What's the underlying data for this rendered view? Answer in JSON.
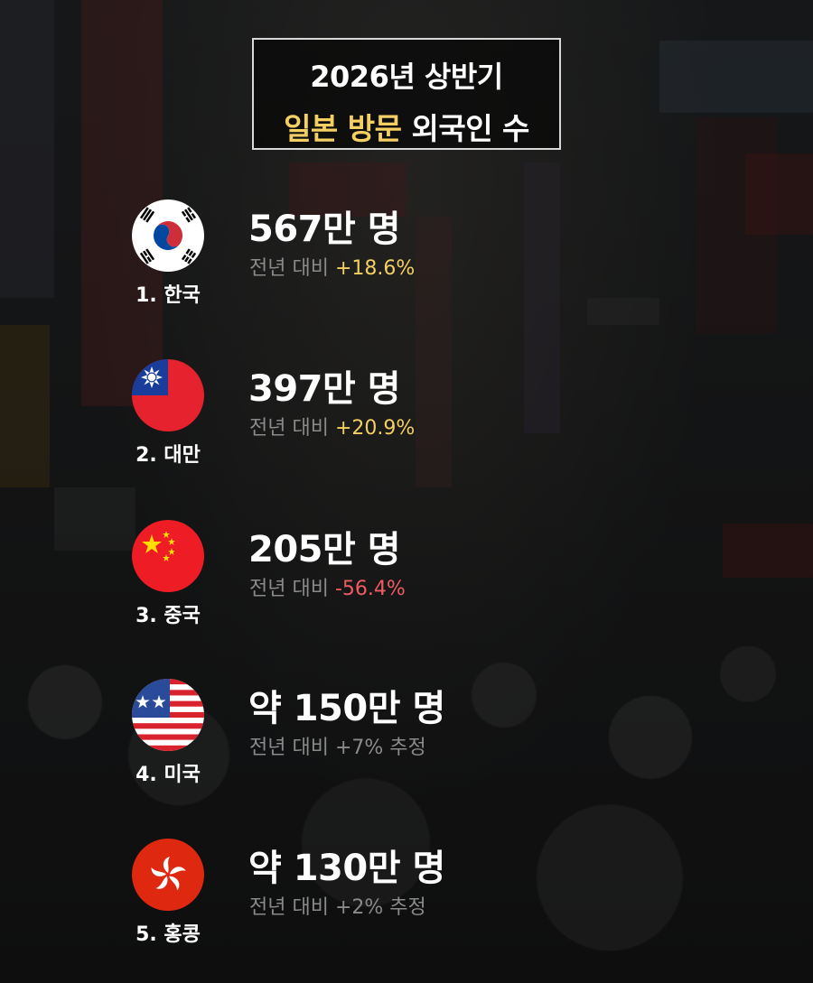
{
  "header": {
    "line1": "2026년 상반기",
    "line2_highlight": "일본 방문",
    "line2_rest": " 외국인 수"
  },
  "colors": {
    "accent_gold": "#f4cf62",
    "negative_red": "#ef5b63",
    "muted_gray": "#8a8a8a"
  },
  "ranking": [
    {
      "rank_label": "1. 한국",
      "count": "567만 명",
      "change_prefix": "전년 대비 ",
      "change_value": "+18.6%",
      "flag": "south-korea-flag-icon"
    },
    {
      "rank_label": "2. 대만",
      "count": "397만 명",
      "change_prefix": "전년 대비 ",
      "change_value": "+20.9%",
      "flag": "taiwan-flag-icon"
    },
    {
      "rank_label": "3. 중국",
      "count": "205만 명",
      "change_prefix": "전년 대비 ",
      "change_value": "-56.4%",
      "flag": "china-flag-icon"
    },
    {
      "rank_label": "4. 미국",
      "count": "약 150만 명",
      "change_prefix": "전년 대비 ",
      "change_value": "+7% 추정",
      "flag": "usa-flag-icon"
    },
    {
      "rank_label": "5. 홍콩",
      "count": "약 130만 명",
      "change_prefix": "전년 대비 ",
      "change_value": "+2% 추정",
      "flag": "hong-kong-flag-icon"
    }
  ]
}
